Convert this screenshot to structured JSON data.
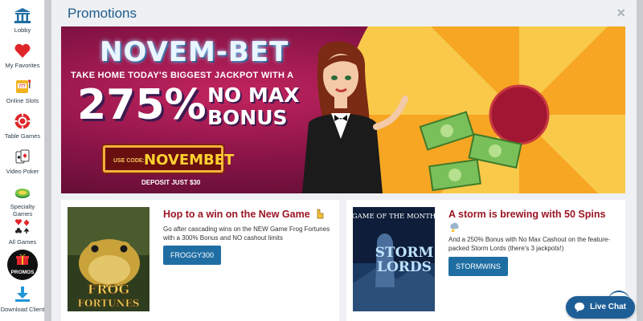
{
  "sidebar": {
    "items": [
      {
        "label": "Lobby",
        "icon": "bank-icon"
      },
      {
        "label": "My Favorites",
        "icon": "heart-icon"
      },
      {
        "label": "Online Slots",
        "icon": "slot-machine-icon"
      },
      {
        "label": "Table Games",
        "icon": "poker-chip-icon"
      },
      {
        "label": "Video Poker",
        "icon": "cards-icon"
      },
      {
        "label": "Specialty Games",
        "icon": "specialty-icon"
      },
      {
        "label": "All Games",
        "icon": "card-suits-icon"
      },
      {
        "label": "PROMOS",
        "icon": "gift-icon"
      },
      {
        "label": "Download Client",
        "icon": "download-icon"
      }
    ]
  },
  "panel": {
    "title": "Promotions",
    "close": "×"
  },
  "banner": {
    "brand": "NOVEM-BET",
    "tagline": "TAKE HOME TODAY'S BIGGEST JACKPOT WITH A",
    "percent": "275%",
    "bonus_line1": "NO MAX",
    "bonus_line2": "BONUS",
    "code_label": "USE CODE:",
    "code": "NOVEMBET",
    "deposit": "DEPOSIT JUST $30"
  },
  "cards": [
    {
      "title": "Hop to a win on the New Game",
      "description": "Go after cascading wins on the NEW Game Frog Fortunes with a 300% Bonus and NO cashout limits",
      "button": "FROGGY300",
      "thumb_text_1": "FROG",
      "thumb_text_2": "FORTUNES"
    },
    {
      "title": "A storm is brewing with 50 Spins",
      "description": "And a 250% Bonus with No Max Cashout on the feature-packed Storm Lords (there's 3 jackpots!)",
      "button": "STORMWINS",
      "thumb_text_1": "GAME OF THE MONTH",
      "thumb_text_2": "STORM",
      "thumb_text_3": "LORDS"
    }
  ],
  "live_chat": {
    "label": "Live Chat"
  },
  "colors": {
    "accent_blue": "#1f6ea3",
    "title_blue": "#1f5b8c",
    "card_title_red": "#9a1624",
    "banner_magenta": "#8a1447"
  }
}
